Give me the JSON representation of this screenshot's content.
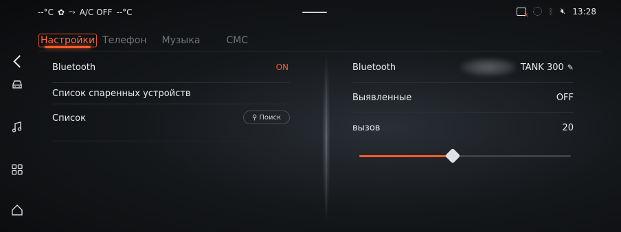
{
  "status_bar": {
    "climate_left_temp": "--°C",
    "ac_text": "A/C OFF",
    "climate_right_temp": "--°C",
    "time": "13:28"
  },
  "tabs": [
    {
      "label": "Настройки",
      "active": true
    },
    {
      "label": "Телефон",
      "active": false
    },
    {
      "label": "Музыка",
      "active": false
    },
    {
      "label": "СМС",
      "active": false
    }
  ],
  "left_panel": {
    "bluetooth_label": "Bluetooth",
    "bluetooth_value": "ON",
    "paired_label": "Список спаренных устройств",
    "list_label": "Список",
    "search_label": "Поиск"
  },
  "right_panel": {
    "bluetooth_label": "Bluetooth",
    "device_name": "TANK 300",
    "discovered_label": "Выявленные",
    "discovered_value": "OFF",
    "call_label": "вызов",
    "call_value": "20",
    "call_level_fraction": 0.44
  },
  "colors": {
    "accent": "#ff5a2a",
    "text": "#e9ecef",
    "muted": "#6f7478"
  },
  "icons": {
    "rail": [
      "car-icon",
      "music-note-icon",
      "apps-grid-icon",
      "home-icon"
    ]
  }
}
